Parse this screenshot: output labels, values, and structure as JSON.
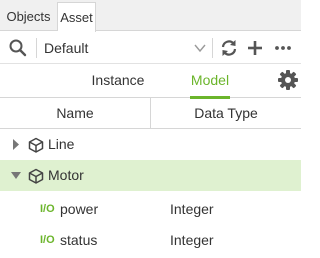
{
  "tabs": {
    "objects": "Objects",
    "asset": "Asset"
  },
  "toolbar": {
    "select_value": "Default"
  },
  "modes": {
    "instance": "Instance",
    "model": "Model"
  },
  "table": {
    "col_name": "Name",
    "col_type": "Data Type"
  },
  "tree": {
    "nodes": [
      {
        "label": "Line",
        "expanded": false
      },
      {
        "label": "Motor",
        "expanded": true,
        "selected": true
      }
    ],
    "properties": [
      {
        "badge": "I/O",
        "name": "power",
        "type": "Integer"
      },
      {
        "badge": "I/O",
        "name": "status",
        "type": "Integer"
      }
    ]
  },
  "colors": {
    "accent": "#6bb52b",
    "selected_row": "#dff1d0"
  },
  "icons": [
    "search-icon",
    "chevron-down-icon",
    "refresh-icon",
    "plus-icon",
    "more-icon",
    "gear-icon",
    "caret-right-icon",
    "caret-down-icon",
    "cube-icon"
  ]
}
